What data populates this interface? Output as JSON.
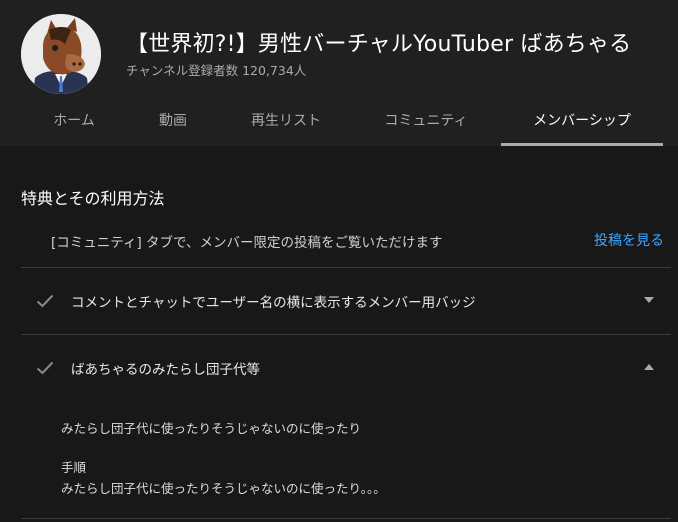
{
  "channel": {
    "title": "【世界初?!】男性バーチャルYouTuber ばあちゃる",
    "subscribers": "チャンネル登録者数 120,734人"
  },
  "tabs": [
    {
      "label": "ホーム"
    },
    {
      "label": "動画"
    },
    {
      "label": "再生リスト"
    },
    {
      "label": "コミュニティ"
    },
    {
      "label": "メンバーシップ",
      "active": true
    }
  ],
  "perks": {
    "heading": "特典とその利用方法",
    "community_text": "[コミュニティ] タブで、メンバー限定の投稿をご覧いただけます",
    "community_link": "投稿を見る",
    "items": [
      {
        "label": "コメントとチャットでユーザー名の横に表示するメンバー用バッジ",
        "expanded": false
      },
      {
        "label": "ばあちゃるのみたらし団子代等",
        "expanded": true
      }
    ],
    "detail": {
      "line1": "みたらし団子代に使ったりそうじゃないのに使ったり",
      "steps_label": "手順",
      "line2": "みたらし団子代に使ったりそうじゃないのに使ったり。。。"
    }
  },
  "colors": {
    "background": "#181818",
    "header": "#202020",
    "link": "#3ea6ff",
    "active_tab_underline": "#aaaaaa"
  }
}
